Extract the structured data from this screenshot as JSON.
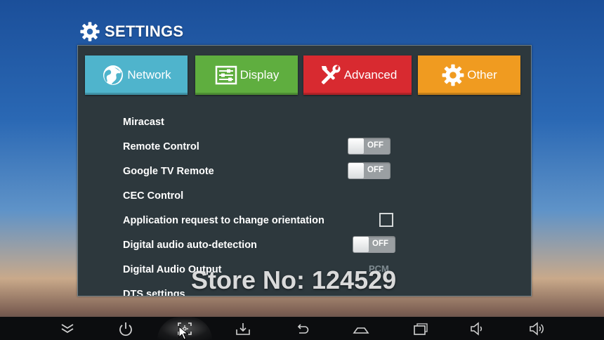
{
  "header": {
    "title": "SETTINGS",
    "icon": "gear-icon"
  },
  "tabs": [
    {
      "label": "Network",
      "icon": "globe-icon",
      "color": "#4fb4cc"
    },
    {
      "label": "Display",
      "icon": "display-sliders-icon",
      "color": "#5fae3f"
    },
    {
      "label": "Advanced",
      "icon": "tools-icon",
      "color": "#d82a30",
      "selected": true
    },
    {
      "label": "Other",
      "icon": "gear-icon",
      "color": "#f09b20"
    }
  ],
  "settings": [
    {
      "label": "Miracast"
    },
    {
      "label": "Remote Control",
      "control": "toggle",
      "state": "OFF"
    },
    {
      "label": "Google TV Remote",
      "control": "toggle",
      "state": "OFF"
    },
    {
      "label": "CEC Control"
    },
    {
      "label": "Application request to change orientation",
      "control": "checkbox",
      "checked": false
    },
    {
      "label": "Digital audio auto-detection",
      "control": "toggle",
      "state": "OFF"
    },
    {
      "label": "Digital Audio Output",
      "value": "PCM"
    },
    {
      "label": "DTS settings"
    }
  ],
  "watermark": "Store No: 124529",
  "navbar": [
    {
      "icon": "chevron-down-icon"
    },
    {
      "icon": "power-icon"
    },
    {
      "icon": "screenshot-icon",
      "highlighted": true
    },
    {
      "icon": "download-icon"
    },
    {
      "icon": "back-icon"
    },
    {
      "icon": "home-icon"
    },
    {
      "icon": "recent-apps-icon"
    },
    {
      "icon": "volume-down-icon"
    },
    {
      "icon": "volume-up-icon"
    }
  ]
}
